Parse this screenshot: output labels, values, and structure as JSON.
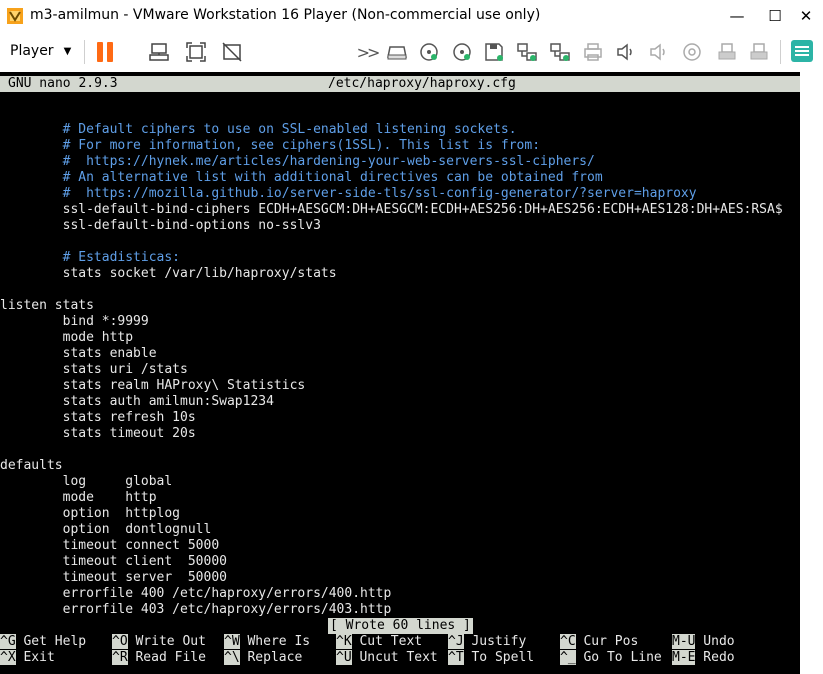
{
  "window": {
    "title": "m3-amilmun - VMware Workstation 16 Player (Non-commercial use only)",
    "minimize_glyph": "—",
    "maximize_glyph": "☐",
    "close_glyph": "✕"
  },
  "toolbar": {
    "player_label": "Player",
    "icons": [
      "pause-icon",
      "send-ctrl-alt-del-icon",
      "fullscreen-icon",
      "unity-icon",
      "forward-icon",
      "hard-disk-icon",
      "cd-drive-icon",
      "cd-drive-2-icon",
      "floppy-icon",
      "network-adapter-icon",
      "network-adapter-2-icon",
      "printer-icon",
      "sound-card-icon",
      "sound-card-2-icon",
      "camera-icon",
      "usb-device-icon",
      "usb-device-2-icon",
      "notes-icon"
    ]
  },
  "nano": {
    "version": "GNU nano 2.9.3",
    "filename": "/etc/haproxy/haproxy.cfg",
    "lines": [
      {
        "text": "        # Default ciphers to use on SSL-enabled listening sockets.",
        "comment": true
      },
      {
        "text": "        # For more information, see ciphers(1SSL). This list is from:",
        "comment": true
      },
      {
        "text": "        #  https://hynek.me/articles/hardening-your-web-servers-ssl-ciphers/",
        "comment": true
      },
      {
        "text": "        # An alternative list with additional directives can be obtained from",
        "comment": true
      },
      {
        "text": "        #  https://mozilla.github.io/server-side-tls/ssl-config-generator/?server=haproxy",
        "comment": true
      },
      {
        "text": "        ssl-default-bind-ciphers ECDH+AESGCM:DH+AESGCM:ECDH+AES256:DH+AES256:ECDH+AES128:DH+AES:RSA$",
        "comment": false
      },
      {
        "text": "        ssl-default-bind-options no-sslv3",
        "comment": false
      },
      {
        "text": "",
        "comment": false
      },
      {
        "text": "        # Estadisticas:",
        "comment": true
      },
      {
        "text": "        stats socket /var/lib/haproxy/stats",
        "comment": false
      },
      {
        "text": "",
        "comment": false
      },
      {
        "text": "listen stats",
        "comment": false
      },
      {
        "text": "        bind *:9999",
        "comment": false
      },
      {
        "text": "        mode http",
        "comment": false
      },
      {
        "text": "        stats enable",
        "comment": false
      },
      {
        "text": "        stats uri /stats",
        "comment": false
      },
      {
        "text": "        stats realm HAProxy\\ Statistics",
        "comment": false
      },
      {
        "text": "        stats auth amilmun:Swap1234",
        "comment": false
      },
      {
        "text": "        stats refresh 10s",
        "comment": false
      },
      {
        "text": "        stats timeout 20s",
        "comment": false
      },
      {
        "text": "",
        "comment": false
      },
      {
        "text": "defaults",
        "comment": false
      },
      {
        "text": "        log     global",
        "comment": false
      },
      {
        "text": "        mode    http",
        "comment": false
      },
      {
        "text": "        option  httplog",
        "comment": false
      },
      {
        "text": "        option  dontlognull",
        "comment": false
      },
      {
        "text": "        timeout connect 5000",
        "comment": false
      },
      {
        "text": "        timeout client  50000",
        "comment": false
      },
      {
        "text": "        timeout server  50000",
        "comment": false
      },
      {
        "text": "        errorfile 400 /etc/haproxy/errors/400.http",
        "comment": false
      },
      {
        "text": "        errorfile 403 /etc/haproxy/errors/403.http",
        "comment": false
      }
    ],
    "status_message": "[ Wrote 60 lines ]",
    "shortcuts": [
      [
        {
          "key": "^G",
          "label": " Get Help"
        },
        {
          "key": "^O",
          "label": " Write Out"
        },
        {
          "key": "^W",
          "label": " Where Is"
        },
        {
          "key": "^K",
          "label": " Cut Text"
        },
        {
          "key": "^J",
          "label": " Justify"
        },
        {
          "key": "^C",
          "label": " Cur Pos"
        },
        {
          "key": "M-U",
          "label": " Undo"
        }
      ],
      [
        {
          "key": "^X",
          "label": " Exit"
        },
        {
          "key": "^R",
          "label": " Read File"
        },
        {
          "key": "^\\",
          "label": " Replace"
        },
        {
          "key": "^U",
          "label": " Uncut Text"
        },
        {
          "key": "^T",
          "label": " To Spell"
        },
        {
          "key": "^_",
          "label": " Go To Line"
        },
        {
          "key": "M-E",
          "label": " Redo"
        }
      ]
    ]
  }
}
